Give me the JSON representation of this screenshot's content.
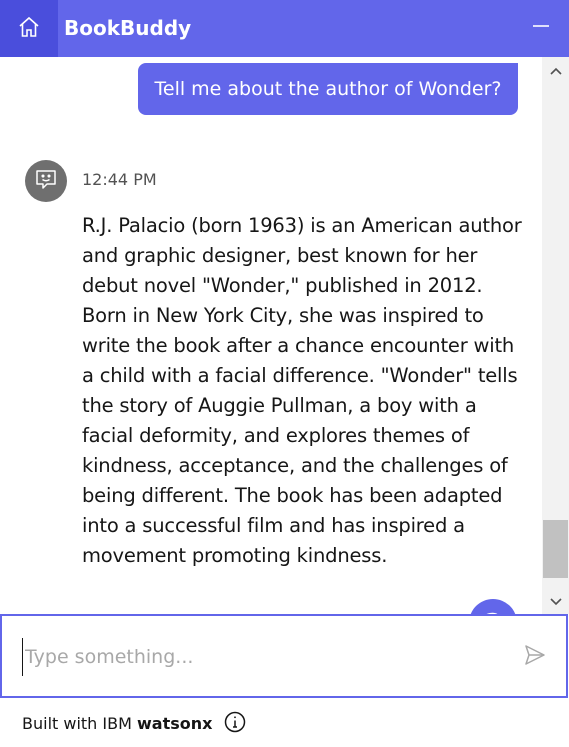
{
  "header": {
    "title": "BookBuddy"
  },
  "conversation": {
    "user_message": "Tell me about the author of Wonder?",
    "bot_timestamp": "12:44 PM",
    "bot_message": "R.J. Palacio (born 1963) is an American author and graphic designer, best known for her debut novel \"Wonder,\" published in 2012. Born in New York City, she was inspired to write the book after a chance encounter with a child with a facial difference. \"Wonder\" tells the story of Auggie Pullman, a boy with a facial deformity, and explores themes of kindness, acceptance, and the challenges of being different. The book has been adapted into a successful film and has inspired a movement promoting kindness."
  },
  "help_button": {
    "label": "?"
  },
  "input": {
    "placeholder": "Type something...",
    "value": ""
  },
  "footer": {
    "prefix": "Built with IBM ",
    "brand": "watsonx"
  },
  "colors": {
    "accent": "#6266ea",
    "accent_dark": "#4a4edc",
    "avatar": "#6f6f6f"
  },
  "icons": [
    "home-icon",
    "minimize-icon",
    "bot-avatar-icon",
    "help-icon",
    "chevron-up-icon",
    "chevron-down-icon",
    "send-icon",
    "info-icon"
  ]
}
